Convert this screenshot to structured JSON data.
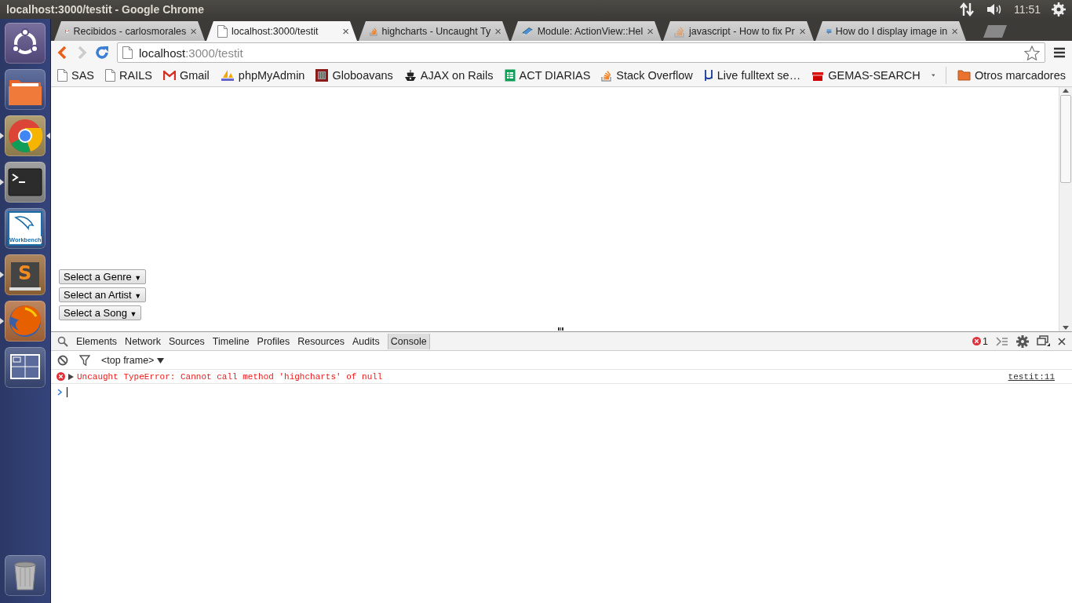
{
  "top_bar": {
    "title": "localhost:3000/testit - Google Chrome",
    "clock": "11:51"
  },
  "launcher": [
    {
      "kind": "ubuntu",
      "running": false,
      "focused": false
    },
    {
      "kind": "files",
      "running": false,
      "focused": false
    },
    {
      "kind": "chrome",
      "running": true,
      "focused": true
    },
    {
      "kind": "terminal",
      "running": true,
      "focused": false
    },
    {
      "kind": "workbench",
      "running": false,
      "focused": false,
      "text": "Workbench"
    },
    {
      "kind": "sublime",
      "running": true,
      "focused": false,
      "text": "S"
    },
    {
      "kind": "firefox",
      "running": true,
      "focused": false
    },
    {
      "kind": "workspaces",
      "running": false,
      "focused": false
    },
    {
      "kind": "trash",
      "running": false,
      "focused": false
    }
  ],
  "tabs": [
    {
      "label": "Recibidos - carlosmorales",
      "kind": "gmail",
      "close": "×",
      "selected": false
    },
    {
      "label": "localhost:3000/testit",
      "kind": "page",
      "close": "×",
      "selected": true
    },
    {
      "label": "highcharts - Uncaught Ty",
      "kind": "stack",
      "close": "×",
      "selected": false
    },
    {
      "label": "Module: ActionView::Hel",
      "kind": "book",
      "close": "×",
      "selected": false
    },
    {
      "label": "javascript - How to fix Pr",
      "kind": "stackfaded",
      "close": "×",
      "selected": false
    },
    {
      "label": "How do I display image in",
      "kind": "exchange",
      "close": "×",
      "selected": false
    }
  ],
  "address": {
    "host": "localhost",
    "path": ":3000/testit"
  },
  "bookmarks": [
    {
      "label": "SAS",
      "kind": "page"
    },
    {
      "label": "RAILS",
      "kind": "page"
    },
    {
      "label": "Gmail",
      "kind": "gmail"
    },
    {
      "label": "phpMyAdmin",
      "kind": "pma"
    },
    {
      "label": "Globoavans",
      "kind": "globo"
    },
    {
      "label": "AJAX on Rails",
      "kind": "ajax"
    },
    {
      "label": "ACT DIARIAS",
      "kind": "sheet"
    },
    {
      "label": "Stack Overflow",
      "kind": "stack"
    },
    {
      "label": "Live fulltext se…",
      "kind": "mu"
    },
    {
      "label": "GEMAS-SEARCH",
      "kind": "gift"
    }
  ],
  "other_bookmarks": "Otros marcadores",
  "page": {
    "selects": [
      {
        "label": "Select a Genre",
        "caret": "▼"
      },
      {
        "label": "Select an Artist",
        "caret": "▼"
      },
      {
        "label": "Select a Song",
        "caret": "▼"
      }
    ]
  },
  "devtools": {
    "tabs": [
      {
        "label": "Elements",
        "selected": false
      },
      {
        "label": "Network",
        "selected": false
      },
      {
        "label": "Sources",
        "selected": false
      },
      {
        "label": "Timeline",
        "selected": false
      },
      {
        "label": "Profiles",
        "selected": false
      },
      {
        "label": "Resources",
        "selected": false
      },
      {
        "label": "Audits",
        "selected": false
      },
      {
        "label": "Console",
        "selected": true
      }
    ],
    "error_count": "1",
    "context": "<top frame>",
    "messages": [
      {
        "kind": "error",
        "text": "Uncaught TypeError: Cannot call method 'highcharts' of null",
        "source": "testit:11"
      }
    ]
  }
}
